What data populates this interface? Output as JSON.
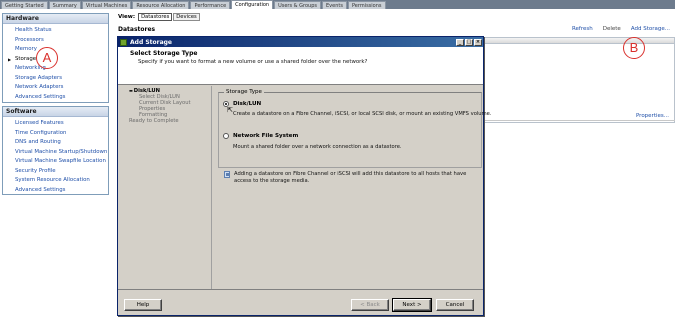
{
  "tabs": [
    "Getting Started",
    "Summary",
    "Virtual Machines",
    "Resource Allocation",
    "Performance",
    "Configuration",
    "Users & Groups",
    "Events",
    "Permissions"
  ],
  "active_tab_index": 5,
  "hardware": {
    "header": "Hardware",
    "items": [
      "Health Status",
      "Processors",
      "Memory",
      "Storage",
      "Networking",
      "Storage Adapters",
      "Network Adapters",
      "Advanced Settings"
    ],
    "selected_index": 3
  },
  "software": {
    "header": "Software",
    "items": [
      "Licensed Features",
      "Time Configuration",
      "DNS and Routing",
      "Virtual Machine Startup/Shutdown",
      "Virtual Machine Swapfile Location",
      "Security Profile",
      "System Resource Allocation",
      "Advanced Settings"
    ]
  },
  "annotations": {
    "a": "A",
    "b": "B",
    "color": "#d9302c"
  },
  "view": {
    "label": "View:",
    "buttons": [
      "Datastores",
      "Devices"
    ],
    "active_index": 0
  },
  "datastores": {
    "title": "Datastores",
    "actions": [
      "Refresh",
      "Delete",
      "Add Storage..."
    ],
    "properties_link": "Properties..."
  },
  "dialog": {
    "title": "Add Storage",
    "controls": [
      "_",
      "□",
      "×"
    ],
    "header_title": "Select Storage Type",
    "header_subtitle": "Specify if you want to format a new volume or use a shared folder over the network?",
    "steps": [
      {
        "label": "Disk/LUN",
        "level": "top",
        "current": true
      },
      {
        "label": "Select Disk/LUN",
        "level": "sub",
        "current": false
      },
      {
        "label": "Current Disk Layout",
        "level": "sub",
        "current": false
      },
      {
        "label": "Properties",
        "level": "sub",
        "current": false
      },
      {
        "label": "Formatting",
        "level": "sub",
        "current": false
      },
      {
        "label": "Ready to Complete",
        "level": "top",
        "current": false
      }
    ],
    "group_label": "Storage Type",
    "options": [
      {
        "label": "Disk/LUN",
        "description": "Create a datastore on a Fibre Channel, iSCSI, or local SCSI disk, or mount an existing VMFS volume.",
        "checked": true
      },
      {
        "label": "Network File System",
        "description": "Mount a shared folder over a network connection as a datastore.",
        "checked": false
      }
    ],
    "info_text": "Adding a datastore on Fibre Channel or iSCSI will add this datastore to all hosts that have access to the storage media.",
    "buttons": {
      "help": "Help",
      "back": "< Back",
      "next": "Next >",
      "cancel": "Cancel"
    }
  },
  "colors": {
    "tabbar": "#6d7b8d",
    "link": "#1f4fa8",
    "dialog_bg": "#d4d0c8",
    "titlebar": "#0a246a",
    "accent_green": "#6fa32b"
  }
}
